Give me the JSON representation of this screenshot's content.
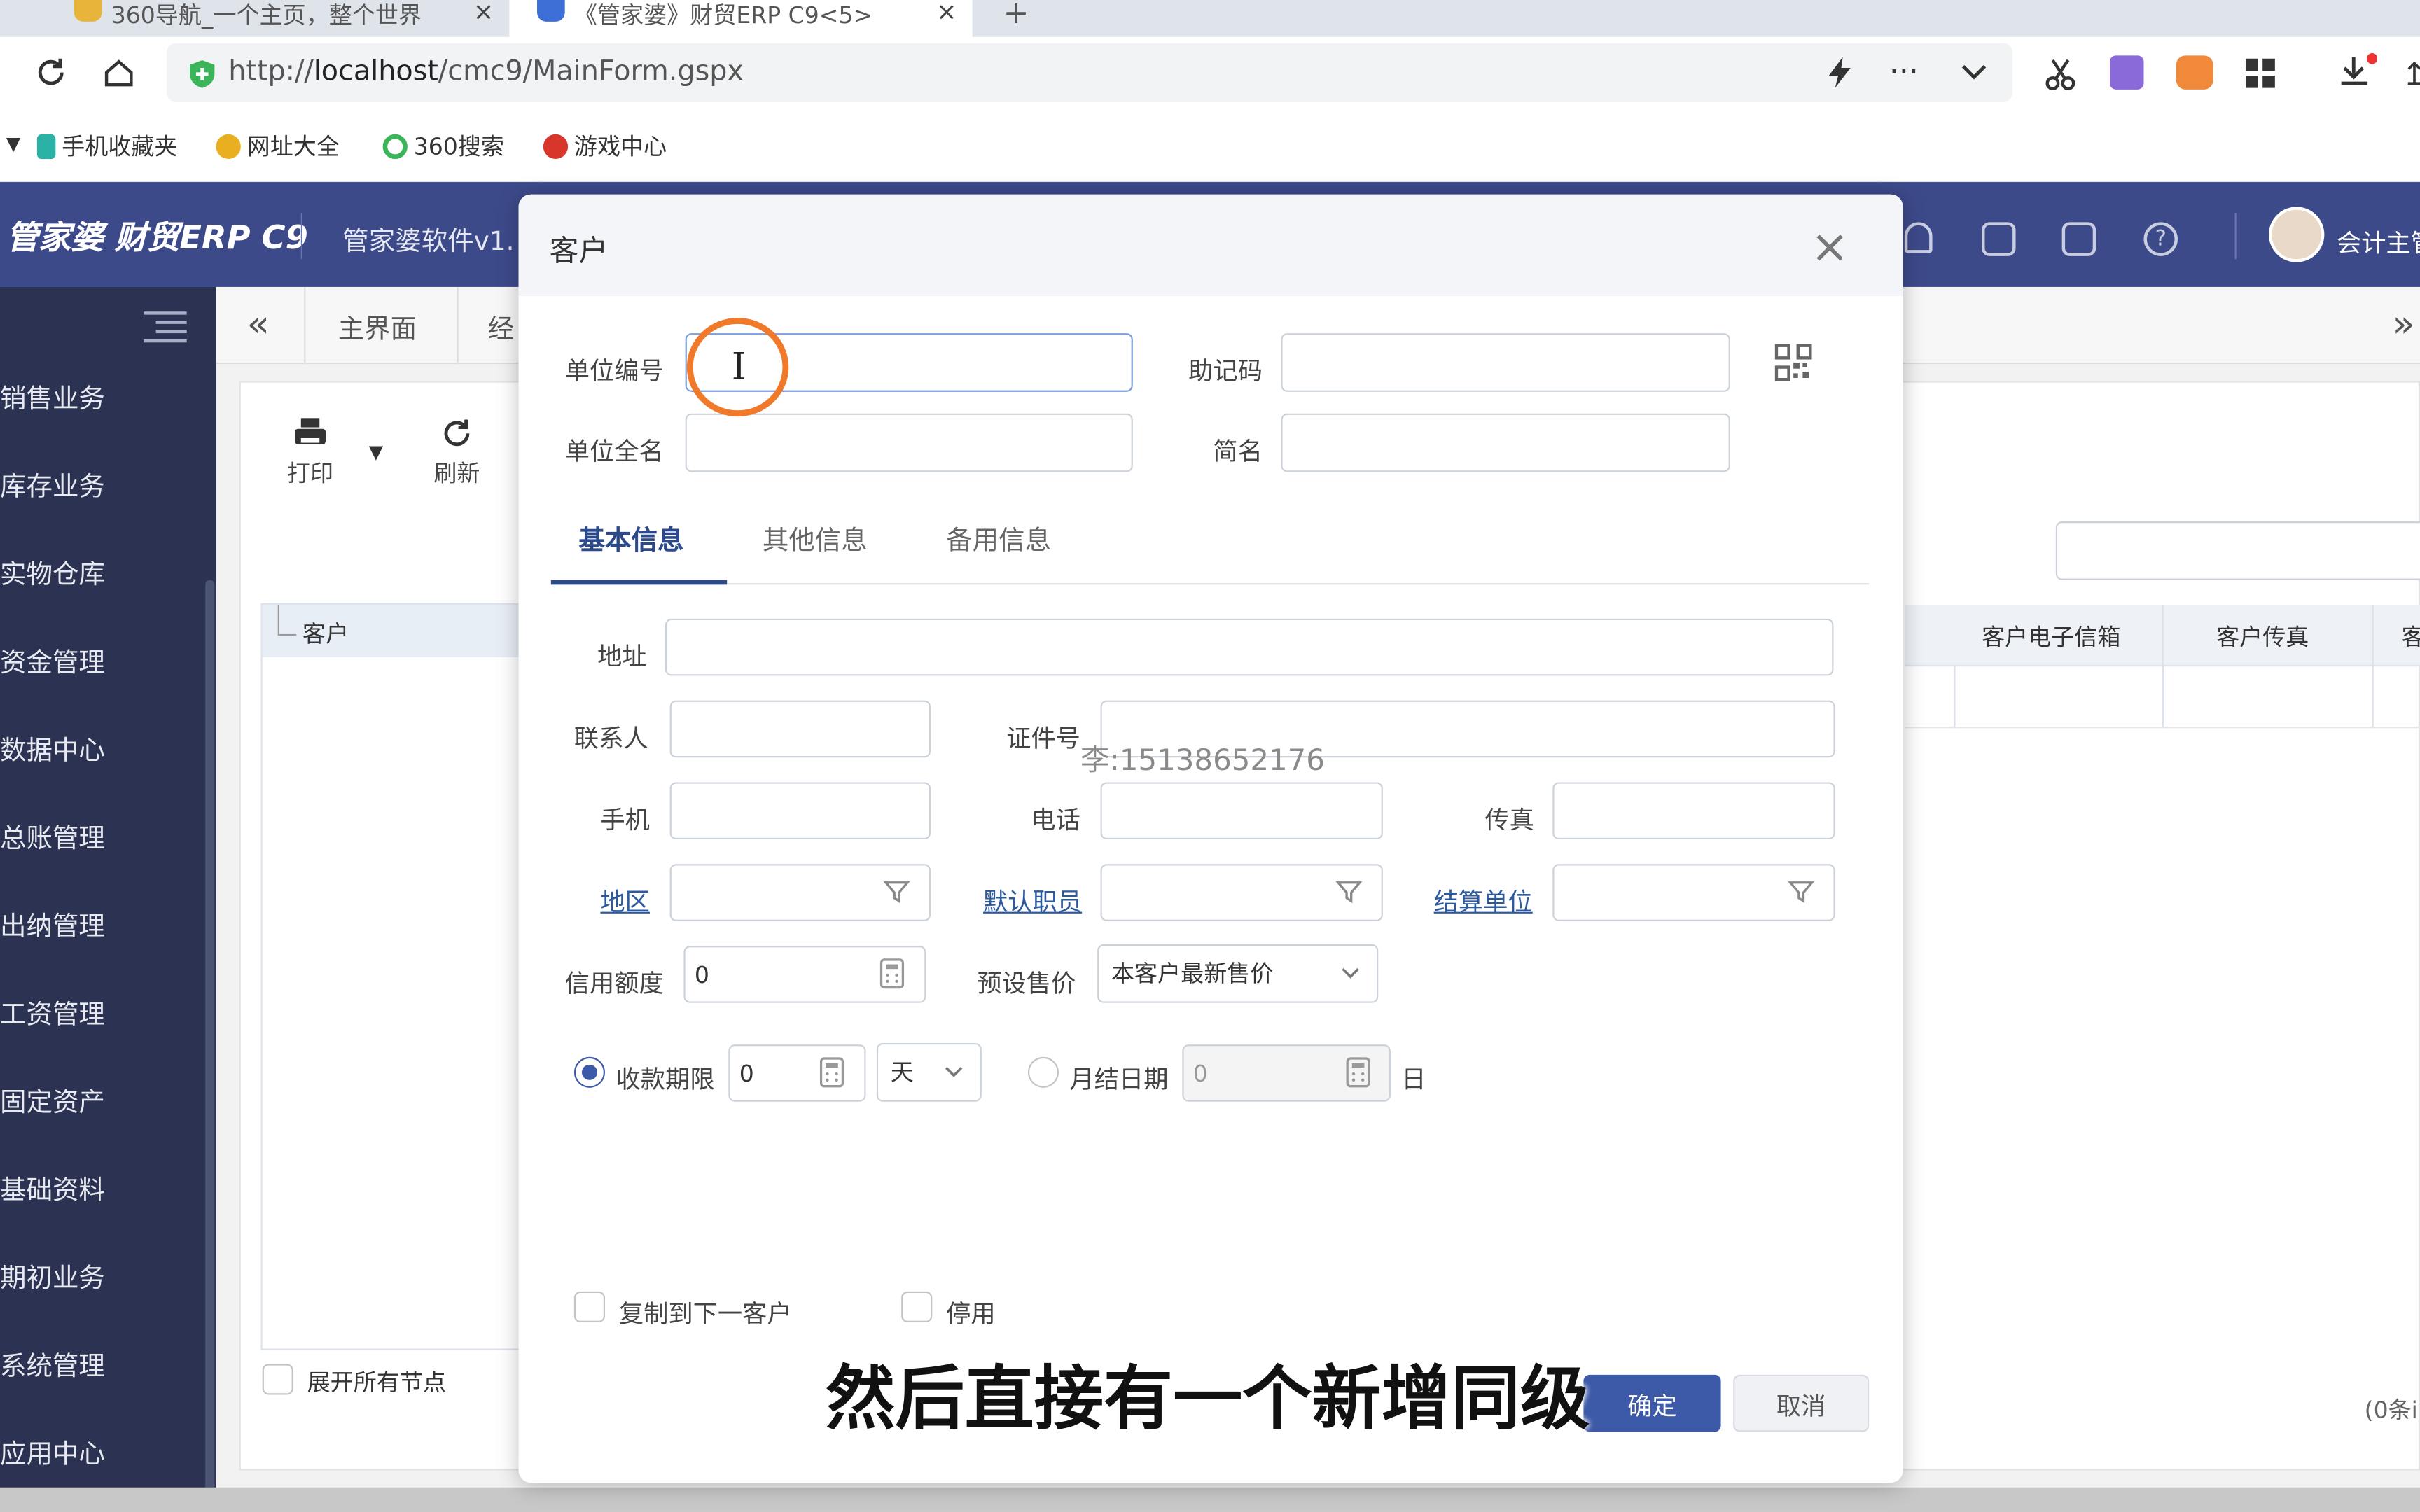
{
  "browser": {
    "tabs": [
      {
        "title": "360导航_一个主页，整个世界",
        "close": "×"
      },
      {
        "title": "《管家婆》财贸ERP C9<5>",
        "close": "×"
      }
    ],
    "new_tab": "+",
    "url_prefix": "http://",
    "url_host": "localhost",
    "url_path": "/cmc9/MainForm.gspx",
    "bookmarks": [
      "手机收藏夹",
      "网址大全",
      "360搜索",
      "游戏中心"
    ]
  },
  "app": {
    "logo": "管家婆 财贸ERP C9",
    "version": "管家婆软件v1.",
    "user": "会计主管",
    "sidebar": [
      "销售业务",
      "库存业务",
      "实物仓库",
      "资金管理",
      "数据中心",
      "总账管理",
      "出纳管理",
      "工资管理",
      "固定资产",
      "基础资料",
      "期初业务",
      "系统管理",
      "应用中心"
    ],
    "tabs": [
      "主界面",
      "经"
    ],
    "collapse": "«",
    "expand": "»",
    "toolbar": {
      "print": "打印",
      "refresh": "刷新"
    },
    "tree_header": "客户",
    "expand_all": "展开所有节点",
    "grid_headers": [
      "客户电子信箱",
      "客户传真",
      "客"
    ],
    "record_count": "(0条i"
  },
  "dialog": {
    "title": "客户",
    "close": "×",
    "fields": {
      "unit_code": {
        "label": "单位编号",
        "value": ""
      },
      "mnemonic": {
        "label": "助记码",
        "value": ""
      },
      "full_name": {
        "label": "单位全名",
        "value": ""
      },
      "short_name": {
        "label": "简名",
        "value": ""
      }
    },
    "tabs": [
      "基本信息",
      "其他信息",
      "备用信息"
    ],
    "address": {
      "label": "地址",
      "value": ""
    },
    "contact": {
      "label": "联系人",
      "value": ""
    },
    "cert": {
      "label": "证件号",
      "value": ""
    },
    "mobile": {
      "label": "手机",
      "value": ""
    },
    "phone": {
      "label": "电话",
      "value": ""
    },
    "fax": {
      "label": "传真",
      "value": ""
    },
    "region": {
      "label": "地区",
      "value": ""
    },
    "default_staff": {
      "label": "默认职员",
      "value": ""
    },
    "settle_unit": {
      "label": "结算单位",
      "value": ""
    },
    "credit": {
      "label": "信用额度",
      "value": "0"
    },
    "preset_price": {
      "label": "预设售价",
      "value": "本客户最新售价"
    },
    "receive_term": {
      "label": "收款期限",
      "value": "0",
      "unit": "天"
    },
    "monthly_date": {
      "label": "月结日期",
      "value": "0",
      "suffix": "日"
    },
    "copy_next": "复制到下一客户",
    "disabled": "停用",
    "ok": "确定",
    "cancel": "取消"
  },
  "watermark": "李:15138652176",
  "subtitle": "然后直接有一个新增同级",
  "colors": {
    "header": "#3d4a8a",
    "sidebar": "#2c3352",
    "accent": "#3d5aa8",
    "highlight": "#f07a2a"
  }
}
